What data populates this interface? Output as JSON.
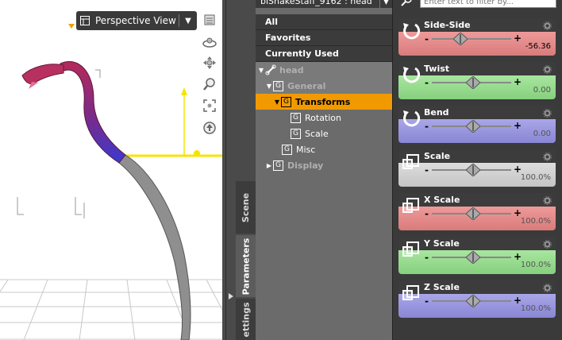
{
  "viewport": {
    "view_label": "Perspective View"
  },
  "node_selector": {
    "label": "biShakeStaff_9162 : head"
  },
  "filters": [
    "All",
    "Favorites",
    "Currently Used"
  ],
  "tree": {
    "root": "head",
    "general": "General",
    "transforms": "Transforms",
    "rotation": "Rotation",
    "scale": "Scale",
    "misc": "Misc",
    "display": "Display"
  },
  "tabs": {
    "scene": "Scene",
    "parameters": "Parameters",
    "settings": "ettings"
  },
  "search": {
    "placeholder": "Enter text to filter by..."
  },
  "params": [
    {
      "name": "Side-Side",
      "value": "-56.36",
      "color": "#e08a8a",
      "slider_position": 0.36
    },
    {
      "name": "Twist",
      "value": "0.00",
      "color": "#92d88a",
      "slider_position": 0.52
    },
    {
      "name": "Bend",
      "value": "0.00",
      "color": "#9592de",
      "slider_position": 0.52
    },
    {
      "name": "Scale",
      "value": "100.0%",
      "color": "#cccccc",
      "slider_position": 0.52
    },
    {
      "name": "X Scale",
      "value": "100.0%",
      "color": "#e08a8a",
      "slider_position": 0.52
    },
    {
      "name": "Y Scale",
      "value": "100.0%",
      "color": "#92d88a",
      "slider_position": 0.52
    },
    {
      "name": "Z Scale",
      "value": "100.0%",
      "color": "#9592de",
      "slider_position": 0.52
    }
  ],
  "colors": {
    "selection": "#f19a00",
    "panel_dark": "#3a3a3a",
    "tree_bg": "#6b6b6b",
    "gizmo_yellow": "#f5e400"
  }
}
